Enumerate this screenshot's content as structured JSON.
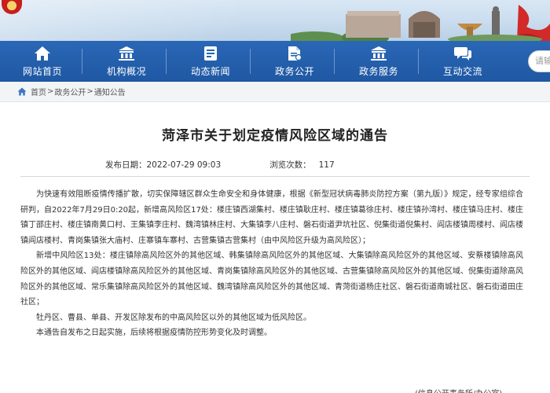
{
  "nav": {
    "items": [
      {
        "label": "网站首页",
        "icon": "home-icon"
      },
      {
        "label": "机构概况",
        "icon": "institution-icon"
      },
      {
        "label": "动态新闻",
        "icon": "news-icon"
      },
      {
        "label": "政务公开",
        "icon": "document-icon"
      },
      {
        "label": "政务服务",
        "icon": "service-building-icon"
      },
      {
        "label": "互动交流",
        "icon": "chat-icon"
      }
    ],
    "search_placeholder": "请输入"
  },
  "breadcrumb": {
    "items": [
      "首页",
      "政务公开",
      "通知公告"
    ],
    "separator": ">"
  },
  "article": {
    "title": "菏泽市关于划定疫情风险区域的通告",
    "publish_label": "发布日期：",
    "publish_date": "2022-07-29 09:03",
    "views_label": "浏览次数：",
    "views": "117",
    "paragraphs": [
      "为快速有效阻断疫情传播扩散，切实保障辖区群众生命安全和身体健康，根据《新型冠状病毒肺炎防控方案（第九版）》规定，经专家组综合研判，自2022年7月29日0:20起，新增高风险区17处：楼庄镇西湖集村、楼庄镇耿庄村、楼庄镇葛徐庄村、楼庄镇孙湾村、楼庄镇马庄村、楼庄镇丁邵庄村、楼庄镇南黄口村、王集镇李庄村、魏湾镇林庄村、大集镇李八庄村、磐石街道尹坑社区、倪集街道倪集村、阎店楼镇周楼村、阎店楼镇阎店楼村、青岗集镇张大庙村、庄寨镇车寨村、古营集镇古营集村（由中风险区升级为高风险区）；",
      "新增中风险区13处：楼庄镇除高风险区外的其他区域、韩集镇除高风险区外的其他区域、大集镇除高风险区外的其他区域、安蔡楼镇除高风险区外的其他区域、阎店楼镇除高风险区外的其他区域、青岗集镇除高风险区外的其他区域、古营集镇除高风险区外的其他区域、倪集街道除高风险区外的其他区域、常乐集镇除高风险区外的其他区域、魏湾镇除高风险区外的其他区域、青菏街道杨庄社区、磐石街道南城社区、磐石街道田庄社区；",
      "牡丹区、曹县、单县、开发区除发布的中高风险区以外的其他区域为低风险区。",
      "本通告自发布之日起实施，后续将根据疫情防控形势变化及时调整。"
    ],
    "signature_partial": "(信息公开事务所/办公室)"
  },
  "colors": {
    "nav_bg": "#2166b2",
    "banner_bg": "#d0e2f2",
    "accent_red": "#c8201c"
  }
}
